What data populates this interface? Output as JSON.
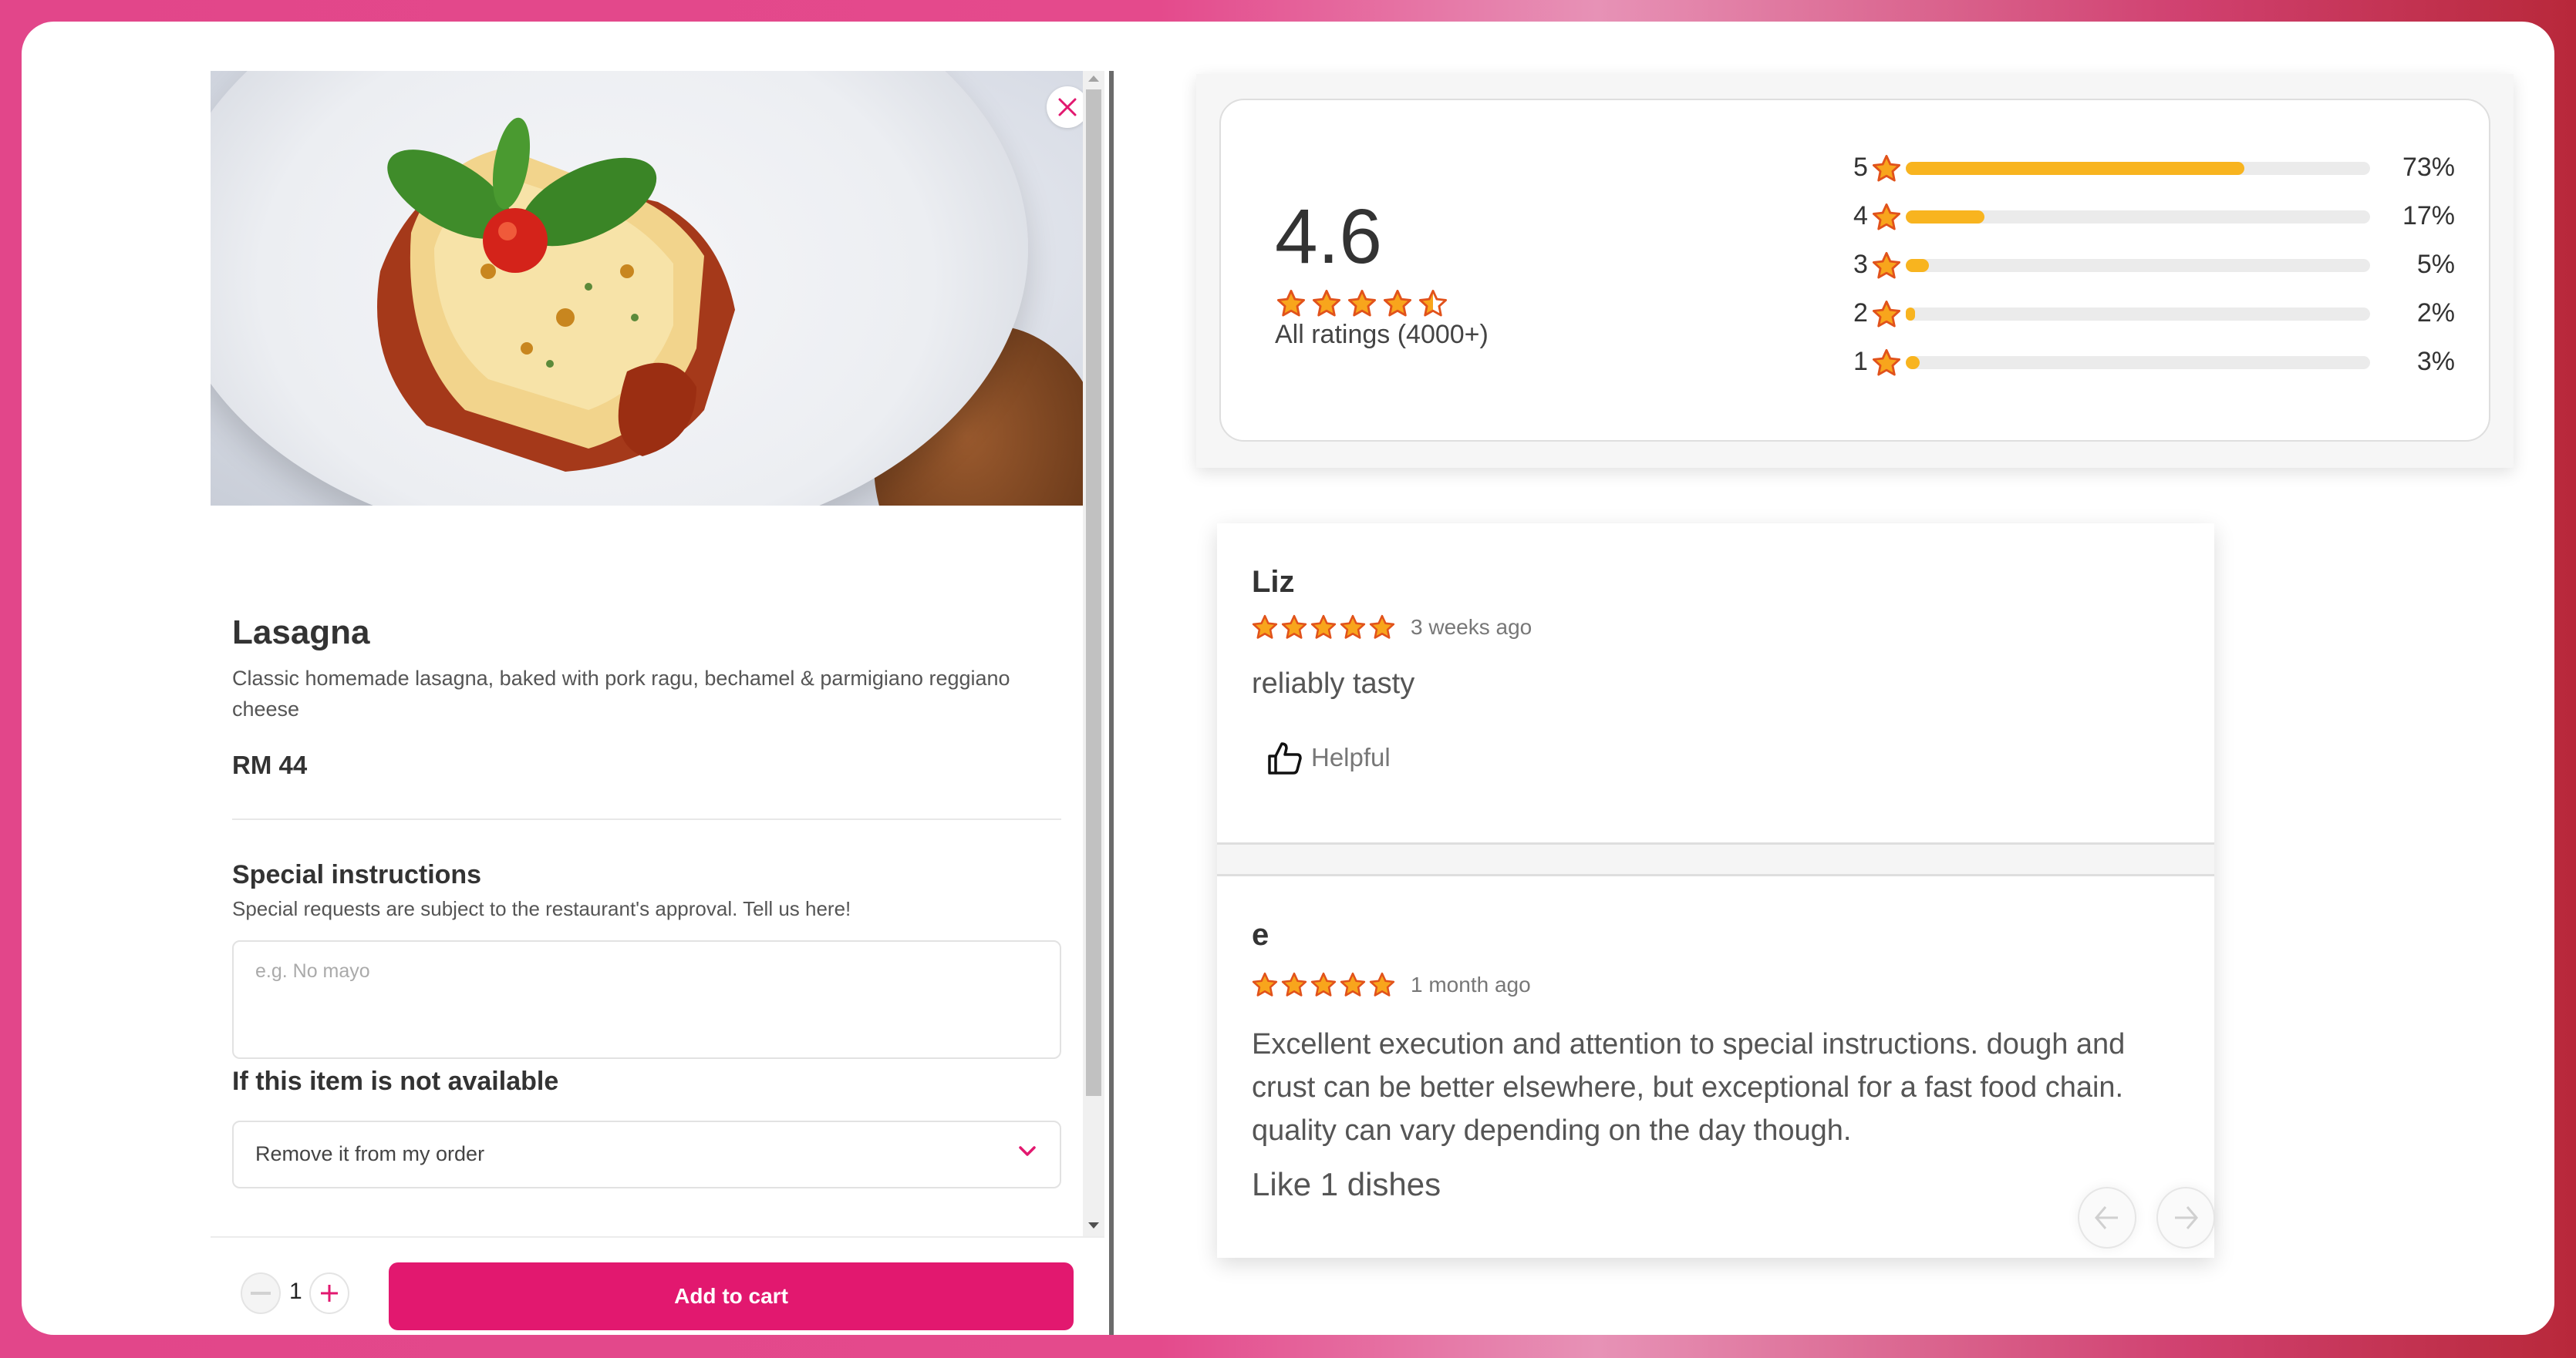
{
  "colors": {
    "brand": "#e2186f",
    "star_fill": "#f8a51c",
    "star_stroke": "#e1521b",
    "bar_fill": "#f8b41f",
    "bar_track": "#ebebeb"
  },
  "item": {
    "title": "Lasagna",
    "description": "Classic homemade lasagna, baked with pork ragu, bechamel & parmigiano reggiano cheese",
    "price": "RM 44",
    "image_alt": "Lasagna in a white bowl topped with basil and tomato"
  },
  "special_instructions": {
    "title": "Special instructions",
    "subtitle": "Special requests are subject to the restaurant's approval. Tell us here!",
    "placeholder": "e.g. No mayo",
    "value": ""
  },
  "unavailable": {
    "title": "If this item is not available",
    "selected": "Remove it from my order"
  },
  "footer": {
    "quantity": "1",
    "add_to_cart_label": "Add to cart"
  },
  "icons": {
    "close": "close-icon",
    "chevron": "chevron-down-icon",
    "minus": "minus-icon",
    "plus": "plus-icon",
    "star": "star-icon",
    "thumbs_up": "thumbs-up-icon",
    "arrow_left": "arrow-left-icon",
    "arrow_right": "arrow-right-icon"
  },
  "ratings": {
    "average": "4.6",
    "average_value": 4.6,
    "all_ratings_label": "All ratings (4000+)",
    "distribution": [
      {
        "stars": "5",
        "percent_label": "73%",
        "percent": 73
      },
      {
        "stars": "4",
        "percent_label": "17%",
        "percent": 17
      },
      {
        "stars": "3",
        "percent_label": "5%",
        "percent": 5
      },
      {
        "stars": "2",
        "percent_label": "2%",
        "percent": 2
      },
      {
        "stars": "1",
        "percent_label": "3%",
        "percent": 3
      }
    ]
  },
  "reviews": [
    {
      "name": "Liz",
      "rating": 5,
      "time": "3 weeks ago",
      "text": "reliably tasty",
      "helpful_label": "Helpful"
    },
    {
      "name": "e",
      "rating": 5,
      "time": "1 month ago",
      "text": "Excellent execution and attention to special instructions. dough and crust can be better elsewhere, but exceptional for a fast food chain. quality can vary depending on the day though.",
      "like_label": "Like 1 dishes"
    }
  ]
}
